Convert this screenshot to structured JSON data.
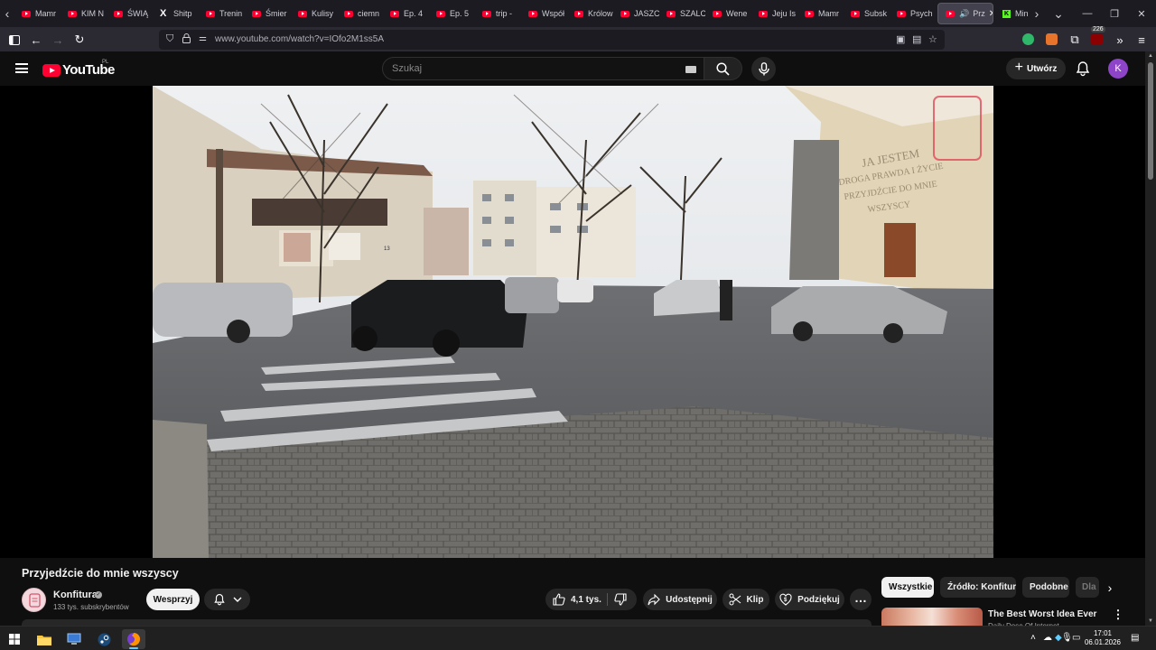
{
  "browser": {
    "tabs": [
      {
        "label": "Mamr",
        "icon": "youtube-icon"
      },
      {
        "label": "KIM N",
        "icon": "youtube-icon"
      },
      {
        "label": "ŚWIĄ",
        "icon": "youtube-icon"
      },
      {
        "label": "Shitp",
        "icon": "x-icon"
      },
      {
        "label": "Trenin",
        "icon": "youtube-icon"
      },
      {
        "label": "Śmier",
        "icon": "youtube-icon"
      },
      {
        "label": "Kulisy",
        "icon": "youtube-icon"
      },
      {
        "label": "ciemn",
        "icon": "youtube-icon"
      },
      {
        "label": "Ep. 4",
        "icon": "youtube-icon"
      },
      {
        "label": "Ep. 5",
        "icon": "youtube-icon"
      },
      {
        "label": "trip -",
        "icon": "youtube-icon"
      },
      {
        "label": "Współ",
        "icon": "youtube-icon"
      },
      {
        "label": "Królow",
        "icon": "youtube-icon"
      },
      {
        "label": "JASZC",
        "icon": "youtube-icon"
      },
      {
        "label": "SZALC",
        "icon": "youtube-icon"
      },
      {
        "label": "Wene",
        "icon": "youtube-icon"
      },
      {
        "label": "Jeju Is",
        "icon": "youtube-icon"
      },
      {
        "label": "Mamr",
        "icon": "youtube-icon"
      },
      {
        "label": "Subsk",
        "icon": "youtube-icon"
      },
      {
        "label": "Psych",
        "icon": "youtube-icon"
      }
    ],
    "active_tab": {
      "label": "Prz"
    },
    "after_active_tab": {
      "label": "Min",
      "icon": "kick-icon"
    },
    "url": "www.youtube.com/watch?v=IOfo2M1ss5A",
    "notification_count": "226"
  },
  "youtube": {
    "region": "PL",
    "logo_text": "YouTube",
    "search_placeholder": "Szukaj",
    "create_label": "Utwórz",
    "avatar_initial": "K",
    "video": {
      "title": "Przyjedźcie do mnie wszyscy",
      "overlay_text": [
        "JA JESTEM",
        "DROGA PRAWDA I ŻYCIE",
        "PRZYJDŹCIE DO MNIE",
        "WSZYSCY"
      ],
      "shop_sign": "13"
    },
    "channel": {
      "name": "Konfitura",
      "subscribers": "133 tys. subskrybentów",
      "support_label": "Wesprzyj"
    },
    "actions": {
      "likes": "4,1 tys.",
      "share": "Udostępnij",
      "clip": "Klip",
      "thanks": "Podziękuj"
    },
    "chips": [
      "Wszystkie",
      "Źródło: Konfitura",
      "Podobne",
      "Dla"
    ],
    "recommendation": {
      "title": "The Best Worst Idea Ever",
      "channel": "Daily Dose Of Internet"
    }
  },
  "taskbar": {
    "time": "17:01",
    "date": "06.01.2026"
  },
  "colors": {
    "youtube_red": "#ff0033",
    "page_bg": "#0f0f0f",
    "avatar_purple": "#8e44c9",
    "firefox_chrome": "#2b2a33"
  }
}
